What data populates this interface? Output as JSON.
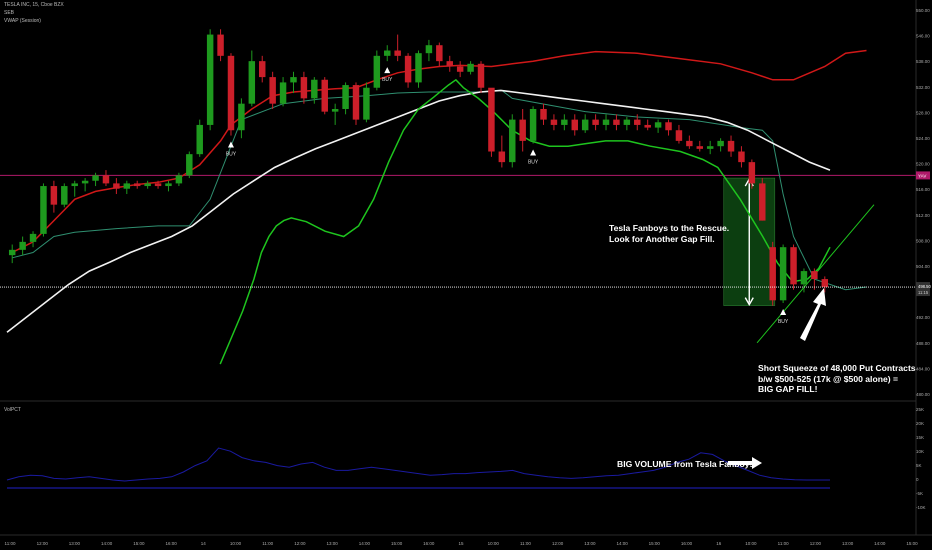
{
  "header": {
    "symbol_line": "TESLA INC, 15, Cboe BZX",
    "indicator1": "SEB",
    "indicator2": "VWAP (Session)",
    "volume_pane_label": "VolPCT"
  },
  "annotations": {
    "rescue_note": "Tesla Fanboys to the Rescue.\nLook for Another Gap Fill.",
    "squeeze_note": "Short Squeeze of 48,000 Put Contracts\nb/w $500-525 (17k @ $500 alone) =\nBIG GAP FILL!",
    "volume_note": "BIG VOLUME from Tesla Fanboys",
    "buy_label": "BUY"
  },
  "price_axis": {
    "ticks": [
      "550.00",
      "546.00",
      "538.00",
      "532.00",
      "528.00",
      "524.00",
      "520.00",
      "516.00",
      "512.00",
      "508.00",
      "504.00",
      "496.00",
      "492.00",
      "488.00",
      "484.00",
      "480.00"
    ],
    "tag_upper": "YAV",
    "tag_last_1": "498.50",
    "tag_last_2": "11:15"
  },
  "volume_axis": {
    "ticks": [
      "25K",
      "20K",
      "15K",
      "10K",
      "5K",
      "0",
      "-5K",
      "-10K"
    ]
  },
  "time_axis": {
    "ticks": [
      "11:00",
      "12:00",
      "13:00",
      "14:00",
      "15:00",
      "16:00",
      "14",
      "10:00",
      "11:00",
      "12:00",
      "13:00",
      "14:00",
      "15:00",
      "16:00",
      "15",
      "10:00",
      "11:00",
      "12:00",
      "13:00",
      "14:00",
      "15:00",
      "16:00",
      "16",
      "10:00",
      "11:00",
      "12:00",
      "13:00",
      "14:00",
      "15:00"
    ]
  },
  "colors": {
    "up": "#1e9a1e",
    "down": "#cc1f2a",
    "upper_band": "#d01818",
    "lower_band": "#1ec41e",
    "vwap": "#2f8f70",
    "ma": "#f2f2f2",
    "volume": "#1a1aa0",
    "last_line": "#ffffff",
    "upper_level": "#b01a6a",
    "gap_box": "#0f4d14"
  },
  "chart_data": {
    "type": "candlestick",
    "title": "TESLA INC, 15, Cboe BZX",
    "ylim": [
      478,
      551
    ],
    "last_price": 498.5,
    "upper_level": 519.5,
    "gap_box": [
      495,
      519
    ],
    "candles": [
      [
        504.5,
        506.5,
        503,
        505.5
      ],
      [
        505.5,
        508,
        504.5,
        507
      ],
      [
        507,
        509,
        506,
        508.5
      ],
      [
        508.5,
        518,
        508,
        517.5
      ],
      [
        517.5,
        518.5,
        512.5,
        514
      ],
      [
        514,
        518,
        513.5,
        517.5
      ],
      [
        517.5,
        518.5,
        515.5,
        518
      ],
      [
        518,
        519,
        516.5,
        518.5
      ],
      [
        518.5,
        520,
        517.5,
        519.5
      ],
      [
        519.5,
        520.5,
        517.5,
        518
      ],
      [
        518,
        519,
        516,
        517
      ],
      [
        517,
        518.5,
        516,
        518
      ],
      [
        518,
        518.5,
        517,
        517.5
      ],
      [
        517.5,
        518.5,
        517,
        518
      ],
      [
        518,
        518.5,
        517,
        517.5
      ],
      [
        517.5,
        518.5,
        516.5,
        518
      ],
      [
        518,
        520,
        517.5,
        519.5
      ],
      [
        519.5,
        524,
        519,
        523.5
      ],
      [
        523.5,
        530,
        523,
        529
      ],
      [
        529,
        547,
        528,
        546
      ],
      [
        546,
        547,
        541,
        542
      ],
      [
        542,
        542.5,
        527,
        528
      ],
      [
        528,
        534,
        526.5,
        533
      ],
      [
        533,
        543,
        532.5,
        541
      ],
      [
        541,
        542,
        537,
        538
      ],
      [
        538,
        539,
        532,
        533
      ],
      [
        533,
        538,
        532.5,
        537
      ],
      [
        537,
        539,
        535,
        538
      ],
      [
        538,
        539,
        533,
        534
      ],
      [
        534,
        538,
        533,
        537.5
      ],
      [
        537.5,
        538,
        531,
        531.5
      ],
      [
        531.5,
        533,
        529,
        532
      ],
      [
        532,
        537,
        531,
        536.5
      ],
      [
        536.5,
        537,
        529,
        530
      ],
      [
        530,
        537,
        529.5,
        536
      ],
      [
        536,
        543,
        535.5,
        542
      ],
      [
        542,
        544,
        541,
        543
      ],
      [
        543,
        546,
        541,
        542
      ],
      [
        542,
        542.5,
        536,
        537
      ],
      [
        537,
        543,
        536,
        542.5
      ],
      [
        542.5,
        545,
        541,
        544
      ],
      [
        544,
        544.5,
        540,
        541
      ],
      [
        541,
        542,
        539,
        540
      ],
      [
        540,
        541,
        538,
        539
      ],
      [
        539,
        541,
        538.5,
        540.5
      ],
      [
        540.5,
        541,
        535,
        536
      ],
      [
        536,
        535,
        523,
        524
      ],
      [
        524,
        527,
        521,
        522
      ],
      [
        522,
        531,
        521,
        530
      ],
      [
        530,
        532,
        524,
        526
      ],
      [
        526,
        532.5,
        525.5,
        532
      ],
      [
        532,
        533,
        529,
        530
      ],
      [
        530,
        531,
        528,
        529
      ],
      [
        529,
        531,
        528,
        530
      ],
      [
        530,
        531,
        527,
        528
      ],
      [
        528,
        531,
        527.5,
        530
      ],
      [
        530,
        531,
        528,
        529
      ],
      [
        529,
        531,
        528,
        530
      ],
      [
        530,
        531,
        528,
        529
      ],
      [
        529,
        530.5,
        528,
        530
      ],
      [
        530,
        531,
        528,
        529
      ],
      [
        529,
        530,
        528,
        528.5
      ],
      [
        528.5,
        530,
        527.5,
        529.5
      ],
      [
        529.5,
        530,
        527,
        528
      ],
      [
        528,
        529,
        525.5,
        526
      ],
      [
        526,
        527,
        524.5,
        525
      ],
      [
        525,
        526,
        524,
        524.5
      ],
      [
        524.5,
        526,
        523.5,
        525
      ],
      [
        525,
        526.5,
        524,
        526
      ],
      [
        526,
        527,
        523,
        524
      ],
      [
        524,
        525,
        521,
        522
      ],
      [
        522,
        522.5,
        517,
        518
      ],
      [
        518,
        519,
        511,
        511
      ],
      [
        506,
        507,
        495,
        496
      ],
      [
        496,
        506.5,
        495.5,
        506
      ],
      [
        506,
        506.5,
        498,
        499
      ],
      [
        499,
        502,
        497.5,
        501.5
      ],
      [
        501.5,
        502,
        498,
        500
      ],
      [
        500,
        500.5,
        497.5,
        498.5
      ]
    ],
    "buy_signals": [
      21,
      36,
      50,
      74
    ],
    "series": [
      {
        "name": "SEB upper",
        "values": [
          [
            0,
            505
          ],
          [
            1,
            506
          ],
          [
            2,
            507
          ],
          [
            3,
            509
          ],
          [
            4,
            511
          ],
          [
            5,
            513
          ],
          [
            6,
            515
          ],
          [
            8,
            516.5
          ],
          [
            10,
            517.2
          ],
          [
            12,
            517.8
          ],
          [
            14,
            518.2
          ],
          [
            16,
            519
          ],
          [
            18,
            521.5
          ],
          [
            20,
            526
          ],
          [
            21,
            529
          ],
          [
            23,
            532
          ],
          [
            25,
            534.5
          ],
          [
            27,
            535.2
          ],
          [
            29,
            535.5
          ],
          [
            31,
            535.8
          ],
          [
            33,
            536
          ],
          [
            35,
            537.5
          ],
          [
            37,
            538.8
          ],
          [
            39,
            539.5
          ],
          [
            41,
            540
          ],
          [
            43,
            540.2
          ],
          [
            46,
            540
          ],
          [
            48,
            540.5
          ],
          [
            50,
            541
          ],
          [
            53,
            542
          ],
          [
            56,
            542.8
          ],
          [
            60,
            542.5
          ],
          [
            64,
            541.5
          ],
          [
            68,
            540.5
          ],
          [
            71,
            538.8
          ],
          [
            73,
            537.5
          ],
          [
            75,
            537.5
          ],
          [
            78,
            540
          ],
          [
            80,
            542.5
          ],
          [
            82,
            543
          ]
        ]
      },
      {
        "name": "SEB lower",
        "values": [
          [
            57,
            484
          ],
          [
            60,
            489
          ],
          [
            63,
            494
          ],
          [
            66,
            500
          ],
          [
            68,
            505
          ],
          [
            70,
            508
          ],
          [
            72,
            510
          ],
          [
            74,
            511
          ],
          [
            76,
            511.5
          ],
          [
            80,
            510.8
          ],
          [
            85,
            509
          ],
          [
            90,
            508
          ],
          [
            94,
            510
          ],
          [
            98,
            515
          ],
          [
            102,
            522
          ],
          [
            106,
            528
          ],
          [
            110,
            532
          ],
          [
            114,
            534.2
          ],
          [
            118,
            536.5
          ],
          [
            120,
            537.5
          ],
          [
            122,
            536
          ],
          [
            126,
            534
          ],
          [
            130,
            531.5
          ],
          [
            135,
            528
          ],
          [
            140,
            526
          ],
          [
            145,
            525
          ],
          [
            150,
            525
          ],
          [
            155,
            525.5
          ],
          [
            160,
            526
          ],
          [
            166,
            526
          ],
          [
            172,
            525
          ],
          [
            180,
            524
          ],
          [
            186,
            522.5
          ],
          [
            190,
            521
          ],
          [
            196,
            515
          ],
          [
            202,
            508
          ],
          [
            206,
            503
          ],
          [
            210,
            499.5
          ],
          [
            214,
            500
          ],
          [
            217,
            502
          ],
          [
            220,
            506
          ]
        ]
      },
      {
        "name": "VWAP",
        "values": [
          [
            0,
            504
          ],
          [
            2,
            505
          ],
          [
            4,
            508
          ],
          [
            6,
            508.8
          ],
          [
            10,
            509.5
          ],
          [
            14,
            510
          ],
          [
            17,
            510
          ],
          [
            19,
            515
          ],
          [
            22,
            530
          ],
          [
            26,
            533
          ],
          [
            30,
            534
          ],
          [
            34,
            534.5
          ],
          [
            37,
            535
          ],
          [
            40,
            535.2
          ],
          [
            45,
            535.2
          ],
          [
            47,
            535.5
          ],
          [
            48,
            534
          ],
          [
            55,
            531.5
          ],
          [
            60,
            530.5
          ],
          [
            65,
            530
          ],
          [
            70,
            528.5
          ],
          [
            72,
            528
          ],
          [
            73,
            526
          ],
          [
            74,
            516
          ],
          [
            75,
            508
          ],
          [
            77,
            500
          ],
          [
            80,
            498
          ],
          [
            82,
            498.5
          ]
        ]
      },
      {
        "name": "MA",
        "values": [
          [
            0,
            490
          ],
          [
            2,
            493
          ],
          [
            4,
            496
          ],
          [
            6,
            499
          ],
          [
            8,
            501.5
          ],
          [
            10,
            503.2
          ],
          [
            12,
            505
          ],
          [
            14,
            506.5
          ],
          [
            16,
            508
          ],
          [
            18,
            510
          ],
          [
            20,
            513
          ],
          [
            22,
            516
          ],
          [
            24,
            518.5
          ],
          [
            26,
            521
          ],
          [
            28,
            522.8
          ],
          [
            30,
            524.5
          ],
          [
            32,
            526
          ],
          [
            34,
            527.5
          ],
          [
            36,
            529
          ],
          [
            38,
            530.5
          ],
          [
            40,
            532
          ],
          [
            42,
            533.5
          ],
          [
            44,
            534.5
          ],
          [
            46,
            535.2
          ],
          [
            48,
            535.5
          ],
          [
            50,
            535
          ],
          [
            52,
            534.5
          ],
          [
            54,
            534
          ],
          [
            56,
            533.5
          ],
          [
            58,
            533
          ],
          [
            60,
            532.5
          ],
          [
            62,
            532
          ],
          [
            64,
            531.5
          ],
          [
            66,
            531
          ],
          [
            68,
            530.5
          ],
          [
            70,
            529.5
          ],
          [
            72,
            528
          ],
          [
            74,
            526
          ],
          [
            76,
            524
          ],
          [
            78,
            522
          ],
          [
            80,
            520.5
          ]
        ]
      }
    ],
    "volume": {
      "name": "VolPCT",
      "ylim": [
        -10000,
        25000
      ],
      "values": [
        2500,
        3500,
        4000,
        3800,
        3000,
        2800,
        3200,
        3500,
        3000,
        2500,
        2200,
        2500,
        2800,
        3000,
        3500,
        5000,
        7000,
        8500,
        12500,
        11500,
        9500,
        8500,
        8000,
        7000,
        6500,
        7500,
        8000,
        6500,
        5500,
        5500,
        6000,
        6500,
        6000,
        5500,
        5000,
        4500,
        4000,
        4200,
        4500,
        4500,
        4800,
        5000,
        5200,
        5500,
        4500,
        4000,
        3500,
        3200,
        3000,
        3200,
        3500,
        3800,
        4000,
        4500,
        5000,
        5500,
        6500,
        8000,
        9000,
        11000,
        10500,
        8500,
        7000,
        5500,
        4000,
        3200,
        2800,
        2600,
        2500,
        2500,
        2500
      ],
      "zero_line": 0
    }
  }
}
